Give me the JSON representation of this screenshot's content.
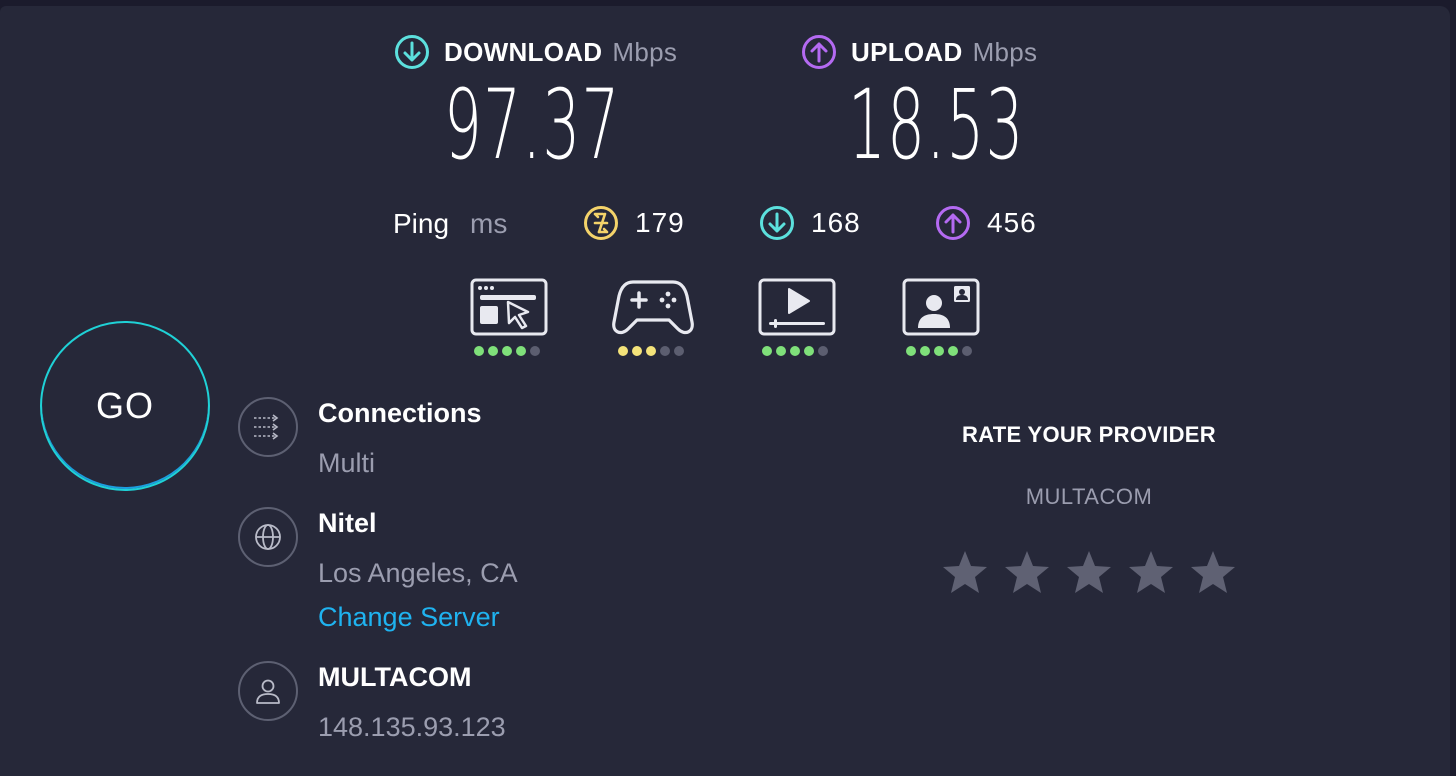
{
  "download": {
    "label": "DOWNLOAD",
    "unit": "Mbps",
    "value": "97.37",
    "icon": "download-arrow-icon",
    "color": "#5ce0dd"
  },
  "upload": {
    "label": "UPLOAD",
    "unit": "Mbps",
    "value": "18.53",
    "icon": "upload-arrow-icon",
    "color": "#b46af2"
  },
  "ping": {
    "label": "Ping",
    "unit": "ms",
    "idle": "179",
    "download": "168",
    "upload": "456",
    "idle_color": "#f4d36a"
  },
  "use_cases": [
    {
      "icon": "web-browsing-icon",
      "rating": 4,
      "color": "#7fe07a"
    },
    {
      "icon": "gaming-icon",
      "rating": 3,
      "color": "#f4e37a"
    },
    {
      "icon": "video-streaming-icon",
      "rating": 4,
      "color": "#7fe07a"
    },
    {
      "icon": "video-chat-icon",
      "rating": 4,
      "color": "#7fe07a"
    }
  ],
  "go_button": {
    "label": "GO"
  },
  "connections": {
    "title": "Connections",
    "value": "Multi"
  },
  "server": {
    "title": "Nitel",
    "location": "Los Angeles, CA",
    "change_label": "Change Server"
  },
  "isp": {
    "title": "MULTACOM",
    "ip": "148.135.93.123"
  },
  "rate": {
    "title": "RATE YOUR PROVIDER",
    "provider": "MULTACOM",
    "star_count": 5
  },
  "colors": {
    "background": "#262839",
    "accent_cyan": "#1fd1d6",
    "link": "#1fb3f0",
    "muted": "#9b9daf",
    "star": "#5f6173"
  }
}
